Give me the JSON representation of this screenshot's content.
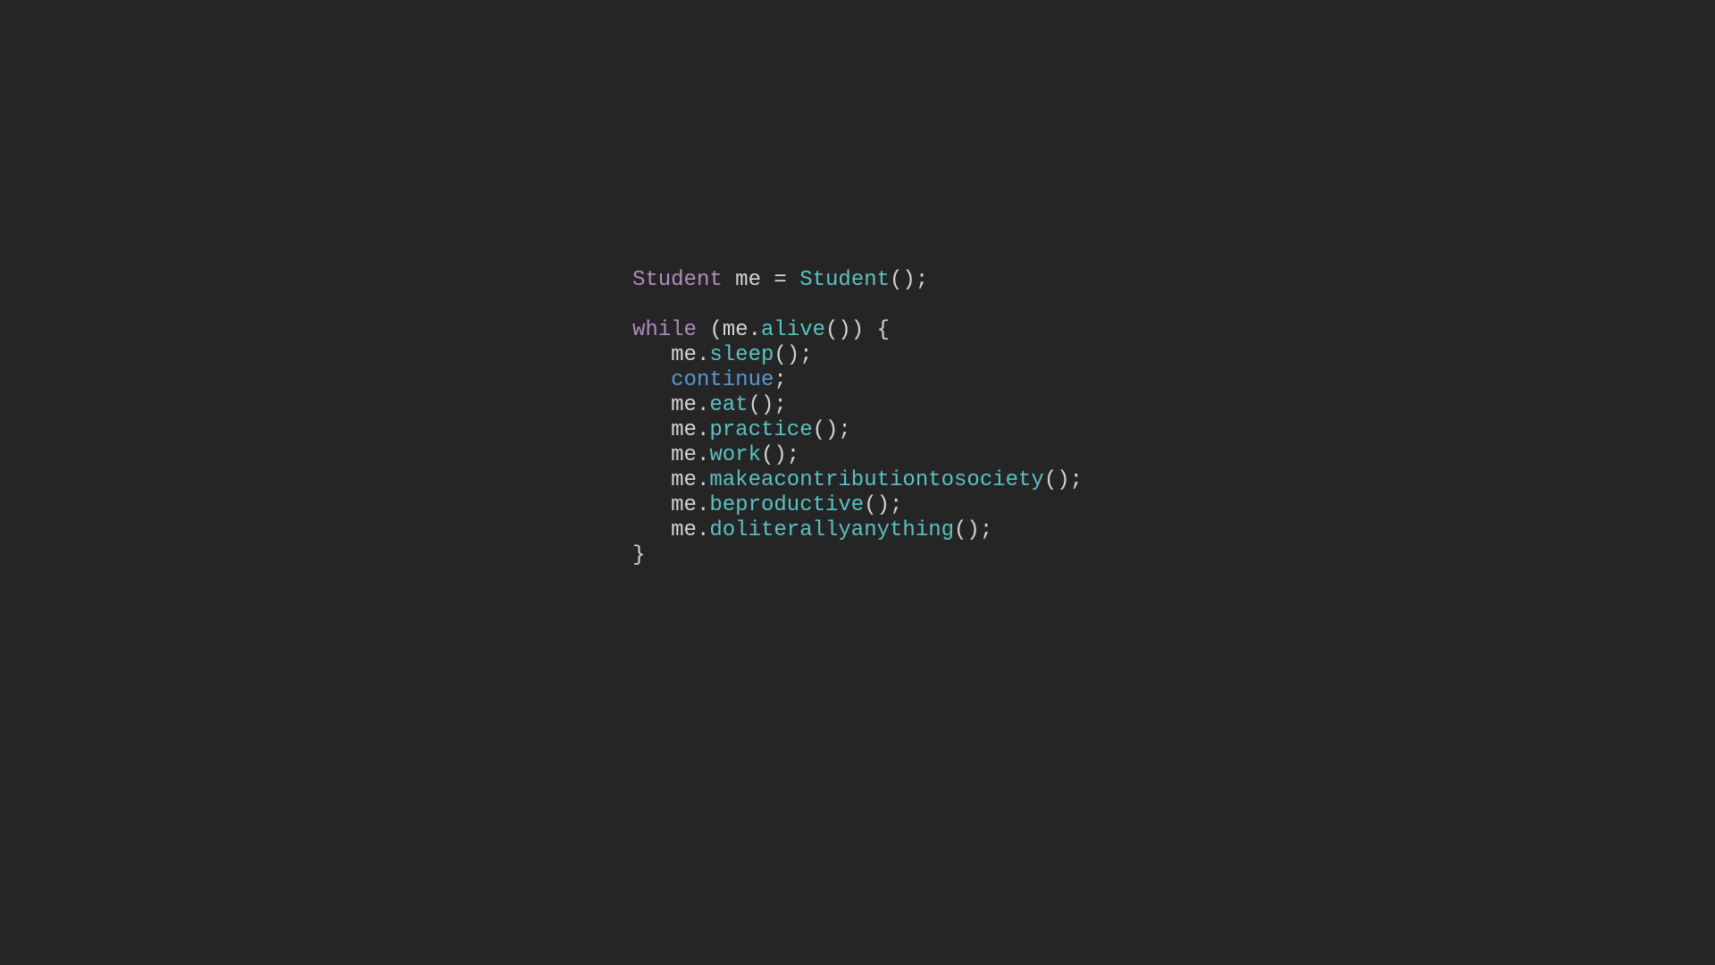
{
  "colors": {
    "background": "#252525",
    "foreground": "#d4d4d4",
    "type": "#b18abf",
    "class": "#59c2c2",
    "func": "#59c2c2",
    "keyword": "#b18abf",
    "keyword2": "#5598d6"
  },
  "code": {
    "type": "Student",
    "var": "me",
    "eq": " = ",
    "ctor": "Student",
    "ctor_call": "();",
    "blank": "",
    "while_kw": "while",
    "while_open": " (",
    "cond_obj": "me",
    "dot": ".",
    "cond_fn": "alive",
    "cond_close": "()) {",
    "indent": "   ",
    "call_tail": "();",
    "semi": ";",
    "close": "}",
    "continue": "continue",
    "calls": {
      "sleep": "sleep",
      "eat": "eat",
      "practice": "practice",
      "work": "work",
      "makeacontributiontosociety": "makeacontributiontosociety",
      "beproductive": "beproductive",
      "doliterallyanything": "doliterallyanything"
    }
  }
}
